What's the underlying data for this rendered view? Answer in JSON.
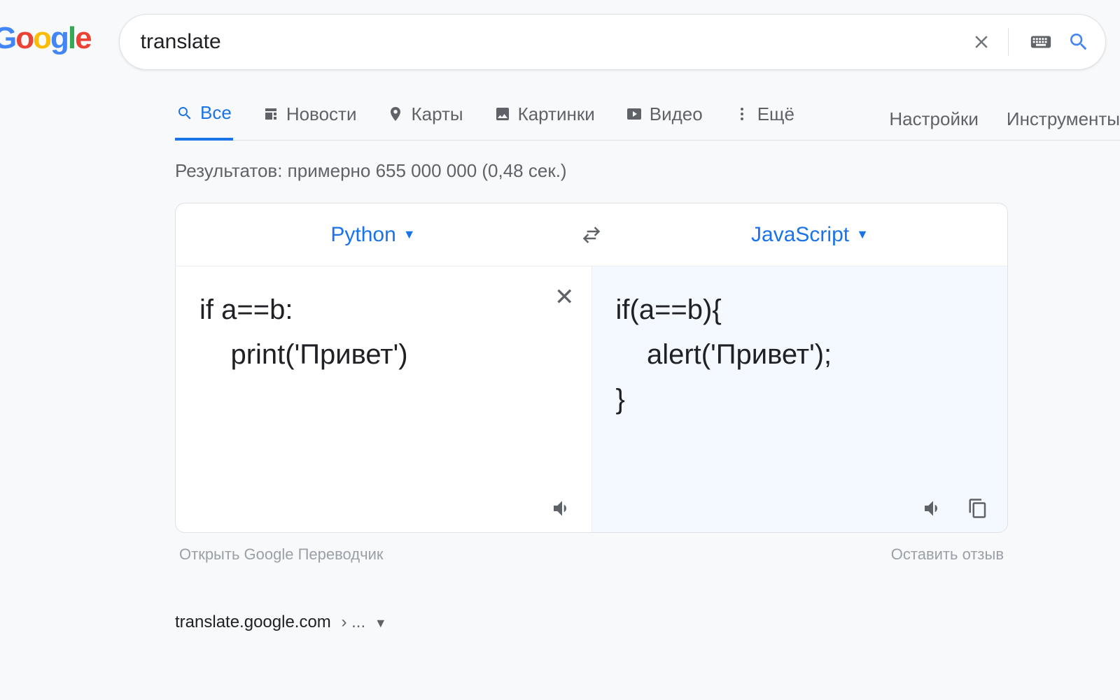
{
  "search": {
    "query": "translate"
  },
  "tabs": {
    "all": "Все",
    "news": "Новости",
    "maps": "Карты",
    "images": "Картинки",
    "video": "Видео",
    "more": "Ещё",
    "settings": "Настройки",
    "tools": "Инструменты"
  },
  "stats": "Результатов: примерно 655 000 000 (0,48 сек.)",
  "translate": {
    "source_lang": "Python",
    "target_lang": "JavaScript",
    "source_text": "if a==b:\n    print('Привет')",
    "target_text": "if(a==b){\n    alert('Привет');\n}",
    "open_link": "Открыть Google Переводчик",
    "feedback": "Оставить отзыв"
  },
  "result": {
    "domain": "translate.google.com",
    "crumb": "› ..."
  }
}
